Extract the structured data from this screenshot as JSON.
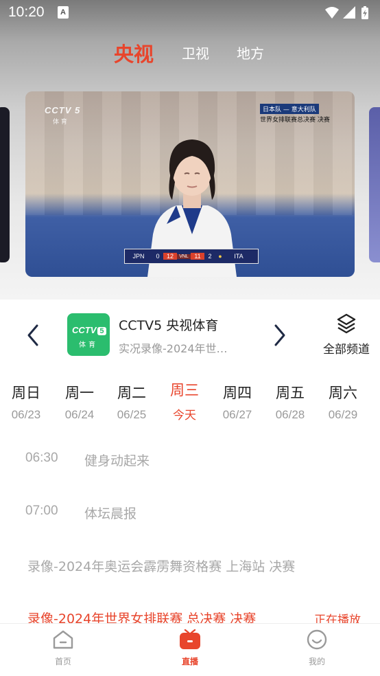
{
  "status_bar": {
    "time": "10:20",
    "notification_glyph": "A"
  },
  "top_tabs": [
    {
      "label": "央视",
      "active": true
    },
    {
      "label": "卫视",
      "active": false
    },
    {
      "label": "地方",
      "active": false
    }
  ],
  "video": {
    "logo_text": "CCTV 5",
    "logo_sub": "体 育",
    "overlay_line1": "日本队 — 意大利队",
    "overlay_line2": "世界女排联赛总决赛 决赛",
    "score": {
      "team_left": "JPN",
      "sets_left": "0",
      "points_left": "12",
      "points_right": "11",
      "sets_right": "2",
      "team_right": "ITA"
    }
  },
  "channel": {
    "logo_text": "CCTV",
    "logo_num": "5",
    "logo_sub": "体育",
    "name": "CCTV5 央视体育",
    "current_program": "实况录像-2024年世…",
    "all_channels_label": "全部频道"
  },
  "days": [
    {
      "name": "周日",
      "date": "06/23",
      "active": false
    },
    {
      "name": "周一",
      "date": "06/24",
      "active": false
    },
    {
      "name": "周二",
      "date": "06/25",
      "active": false
    },
    {
      "name": "周三",
      "date": "今天",
      "active": true
    },
    {
      "name": "周四",
      "date": "06/27",
      "active": false
    },
    {
      "name": "周五",
      "date": "06/28",
      "active": false
    },
    {
      "name": "周六",
      "date": "06/29",
      "active": false
    }
  ],
  "programs": [
    {
      "time": "06:30",
      "name": "健身动起来"
    },
    {
      "time": "07:00",
      "name": "体坛晨报"
    },
    {
      "full": "录像-2024年奥运会霹雳舞资格赛 上海站 决赛"
    },
    {
      "full": "录像-2024年世界女排联赛 总决赛 决赛",
      "badge": "正在播放"
    }
  ],
  "bottom_nav": [
    {
      "label": "首页",
      "icon": "home-icon",
      "active": false
    },
    {
      "label": "直播",
      "icon": "tv-icon",
      "active": true
    },
    {
      "label": "我的",
      "icon": "smile-icon",
      "active": false
    }
  ],
  "colors": {
    "accent": "#e8452c",
    "channel_green": "#2bbd6e"
  }
}
